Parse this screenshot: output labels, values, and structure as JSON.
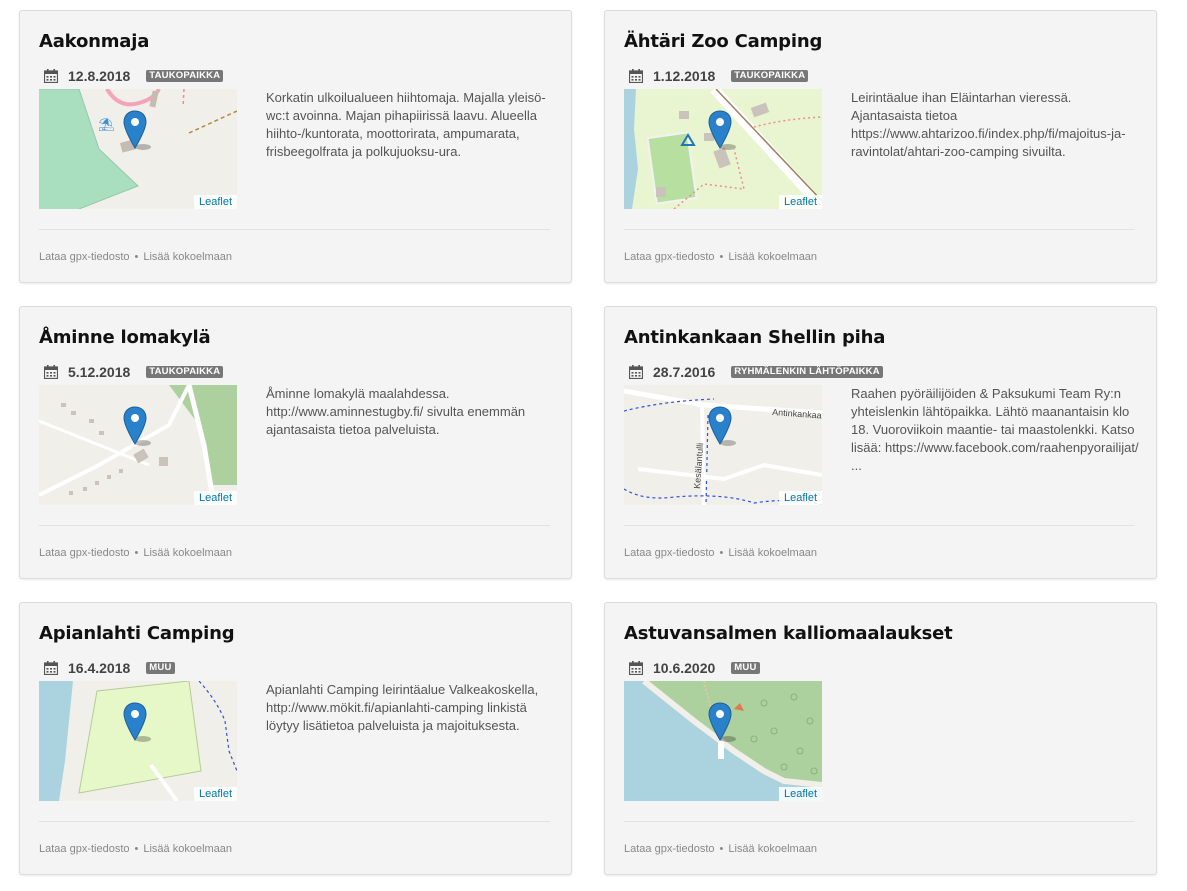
{
  "footer": {
    "gpx_label": "Lataa gpx-tiedosto",
    "separator": "•",
    "collection_label": "Lisää kokoelmaan"
  },
  "map_attribution": "Leaflet",
  "cards": [
    {
      "title": "Aakonmaja",
      "date": "12.8.2018",
      "badge": "TAUKOPAIKKA",
      "description": "Korkatin ulkoilualueen hiihtomaja. Majalla yleisö-wc:t avoinna. Majan pihapiirissä laavu. Alueella hiihto-/kuntorata, moottorirata, ampumarata, frisbeegolfrata ja polkujuoksu-ura."
    },
    {
      "title": "Ähtäri Zoo Camping",
      "date": "1.12.2018",
      "badge": "TAUKOPAIKKA",
      "description": "Leirintäalue ihan Eläintarhan vieressä. Ajantasaista tietoa https://www.ahtarizoo.fi/index.php/fi/majoitus-ja-ravintolat/ahtari-zoo-camping sivuilta."
    },
    {
      "title": "Åminne lomakylä",
      "date": "5.12.2018",
      "badge": "TAUKOPAIKKA",
      "description": "Åminne lomakylä maalahdessa. http://www.aminnestugby.fi/ sivulta enemmän ajantasaista tietoa palveluista."
    },
    {
      "title": "Antinkankaan Shellin piha",
      "date": "28.7.2016",
      "badge": "RYHMÄLENKIN LÄHTÖPAIKKA",
      "description": "Raahen pyöräilijöiden & Paksukumi Team Ry:n yhteislenkin lähtöpaikka. Lähtö maanantaisin klo 18. Vuoroviikoin maantie- tai maastolenkki. Katso lisää: https://www.facebook.com/raahenpyorailijat/ ...",
      "map_labels": [
        "Antinkankaa",
        "Kesälantulli"
      ]
    },
    {
      "title": "Apianlahti Camping",
      "date": "16.4.2018",
      "badge": "MUU",
      "description": "Apianlahti Camping leirintäalue Valkeakoskella, http://www.mökit.fi/apianlahti-camping linkistä löytyy lisätietoa palveluista ja majoituksesta."
    },
    {
      "title": "Astuvansalmen kalliomaalaukset",
      "date": "10.6.2020",
      "badge": "MUU",
      "description": ""
    }
  ],
  "colors": {
    "card_bg": "#f4f4f4",
    "badge_bg": "#777777",
    "link_blue": "#0078a8",
    "pin_blue": "#2a81cb"
  }
}
